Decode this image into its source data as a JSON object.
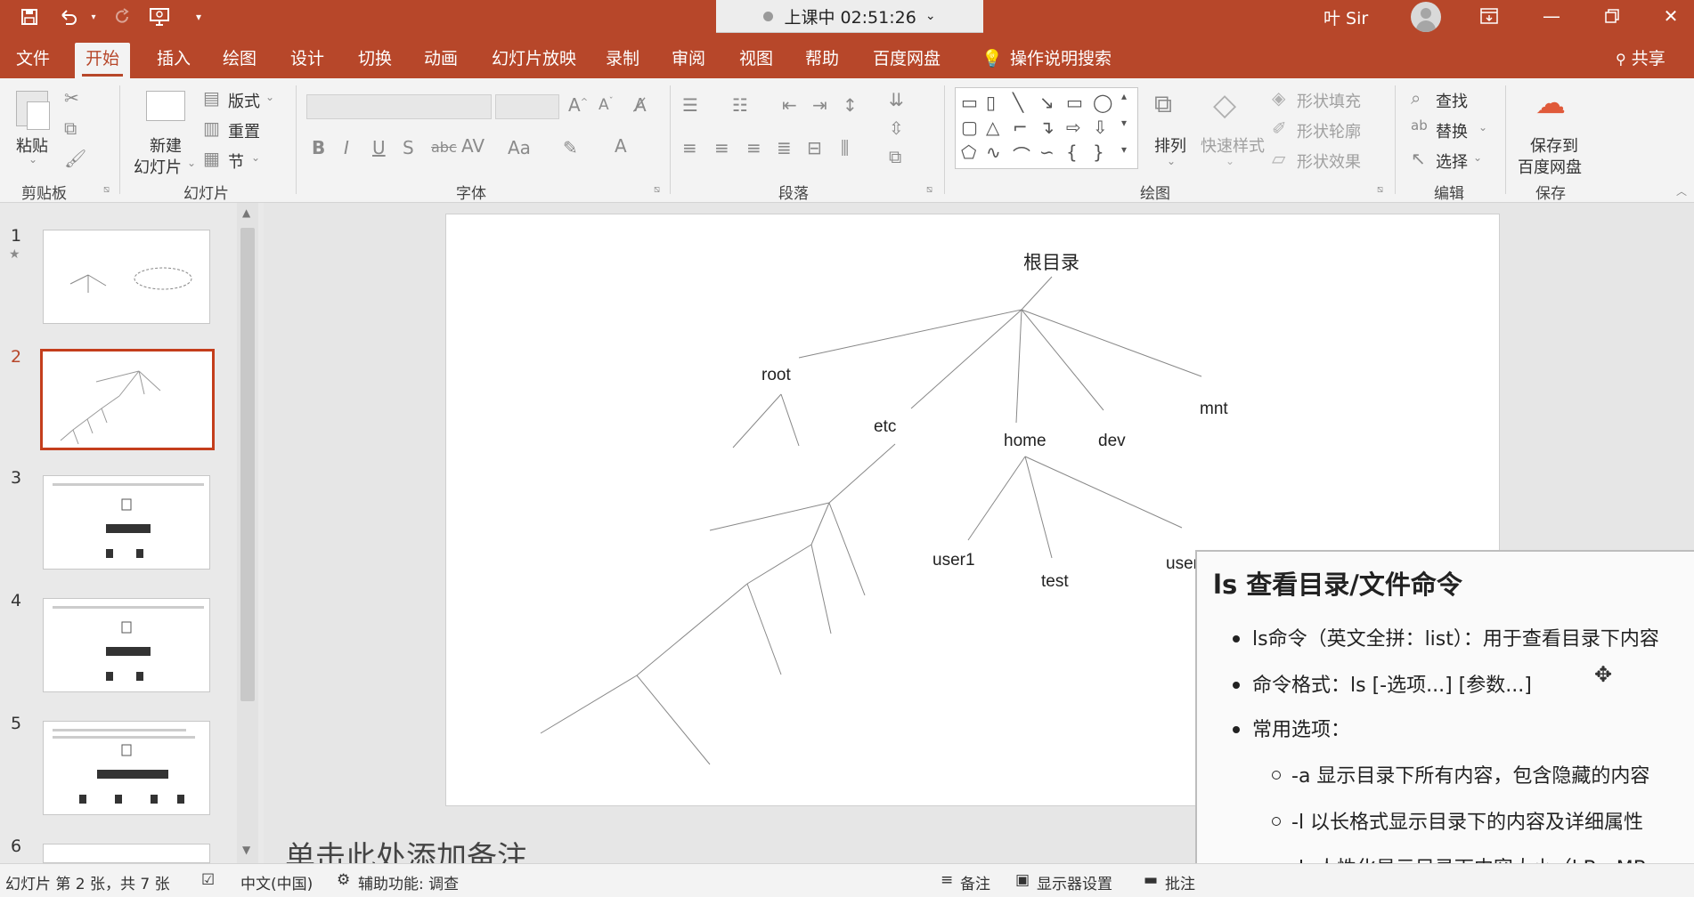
{
  "titlebar": {
    "status": "上课中 02:51:26",
    "user": "叶 Sir"
  },
  "tabs": [
    "文件",
    "开始",
    "插入",
    "绘图",
    "设计",
    "切换",
    "动画",
    "幻灯片放映",
    "录制",
    "审阅",
    "视图",
    "帮助",
    "百度网盘"
  ],
  "search_hint": "操作说明搜索",
  "share": "共享",
  "ribbon": {
    "paste": "粘贴",
    "clipboard": "剪贴板",
    "new_slide_1": "新建",
    "new_slide_2": "幻灯片",
    "layout": "版式",
    "reset": "重置",
    "section": "节",
    "slides_group": "幻灯片",
    "font_group": "字体",
    "paragraph_group": "段落",
    "arrange": "排列",
    "quick_styles": "快速样式",
    "shape_fill": "形状填充",
    "shape_outline": "形状轮廓",
    "shape_effects": "形状效果",
    "drawing_group": "绘图",
    "find": "查找",
    "replace": "替换",
    "select": "选择",
    "editing_group": "编辑",
    "save_to_1": "保存到",
    "save_to_2": "百度网盘",
    "save_group": "保存"
  },
  "thumbnails": [
    "1",
    "2",
    "3",
    "4",
    "5",
    "6"
  ],
  "slide": {
    "root": "根目录",
    "nodes": [
      "root",
      "etc",
      "home",
      "dev",
      "mnt",
      "user1",
      "test",
      "user"
    ]
  },
  "notes_placeholder": "单击此处添加备注",
  "overlay": {
    "title": "ls 查看目录/文件命令",
    "items": [
      "ls命令（英文全拼：list）：用于查看目录下内容",
      "命令格式：ls [-选项...] [参数...]",
      "常用选项："
    ],
    "options": [
      "-a 显示目录下所有内容，包含隐藏的内容",
      "-l 以长格式显示目录下的内容及详细属性",
      "-h 人性化显示目录下内容大小（kB、MB、"
    ]
  },
  "status": {
    "slide_count": "幻灯片 第 2 张，共 7 张",
    "language": "中文(中国)",
    "accessibility": "辅助功能: 调查",
    "notes": "备注",
    "display_settings": "显示器设置",
    "comments": "批注"
  }
}
